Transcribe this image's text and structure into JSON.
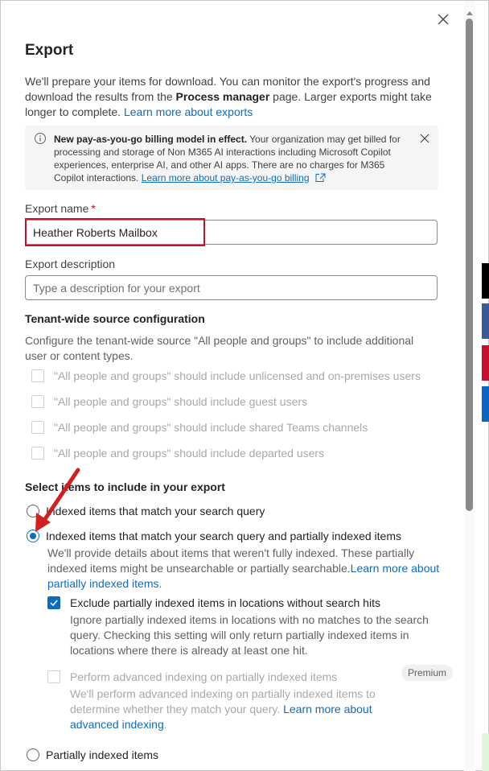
{
  "panel": {
    "title": "Export",
    "intro_prefix": "We'll prepare your items for download. You can monitor the export's progress and download the results from the ",
    "intro_bold": "Process manager",
    "intro_suffix": " page. Larger exports might take longer to complete. ",
    "intro_link": "Learn more about exports"
  },
  "banner": {
    "bold": "New pay-as-you-go billing model in effect.",
    "text": " Your organization may get billed for processing and storage of Non M365 AI interactions including Microsoft Copilot experiences, enterprise AI, and other AI apps. There are no charges for M365 Copilot interactions. ",
    "link": "Learn more about pay-as-you-go billing"
  },
  "export_name": {
    "label": "Export name",
    "required_mark": "*",
    "value": "Heather Roberts Mailbox"
  },
  "export_description": {
    "label": "Export description",
    "placeholder": "Type a description for your export"
  },
  "tenant_config": {
    "title": "Tenant-wide source configuration",
    "description": "Configure the tenant-wide source \"All people and groups\" to include additional user or content types.",
    "options": [
      "\"All people and groups\" should include unlicensed and on-premises users",
      "\"All people and groups\" should include guest users",
      "\"All people and groups\" should include shared Teams channels",
      "\"All people and groups\" should include departed users"
    ]
  },
  "select_items": {
    "title": "Select items to include in your export",
    "option1": "Indexed items that match your search query",
    "option2": "Indexed items that match your search query and partially indexed items",
    "option2_desc": "We'll provide details about items that weren't fully indexed. These partially indexed items might be unsearchable or partially searchable.",
    "option2_link": "Learn more about partially indexed items",
    "exclude_label": "Exclude partially indexed items in locations without search hits",
    "exclude_desc": "Ignore partially indexed items in locations with no matches to the search query. Checking this setting will only return partially indexed items in locations where there is already at least one hit.",
    "advanced_label": "Perform advanced indexing on partially indexed items",
    "advanced_badge": "Premium",
    "advanced_desc": "We'll perform advanced indexing on partially indexed items to determine whether they match your query. ",
    "advanced_link": "Learn more about advanced indexing",
    "option3": "Partially indexed items"
  },
  "colors": {
    "accent": "#0f6cbd",
    "annotation_red": "#c8102e",
    "required_red": "#c50f1f"
  }
}
